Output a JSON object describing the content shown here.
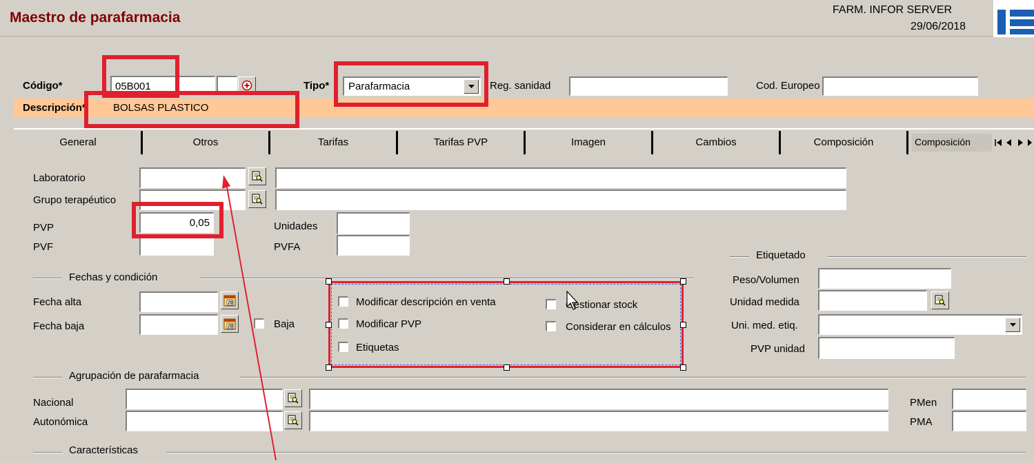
{
  "header": {
    "title": "Maestro de parafarmacia",
    "server": "FARM. INFOR SERVER",
    "date": "29/06/2018",
    "logo_text": "1S",
    "title_color": "#800000"
  },
  "top_form": {
    "codigo_label": "Código*",
    "codigo_value": "05B001",
    "tipo_label": "Tipo*",
    "tipo_value": "Parafarmacia",
    "reg_sanidad_label": "Reg. sanidad",
    "reg_sanidad_value": "",
    "cod_europeo_label": "Cod. Europeo",
    "cod_europeo_value": "",
    "descripcion_label": "Descripción*",
    "descripcion_value": "BOLSAS PLASTICO",
    "descripcion_bg": "#ffc896"
  },
  "tabs": [
    {
      "label": "General"
    },
    {
      "label": "Otros"
    },
    {
      "label": "Tarifas"
    },
    {
      "label": "Tarifas PVP"
    },
    {
      "label": "Imagen"
    },
    {
      "label": "Cambios"
    },
    {
      "label": "Composición"
    },
    {
      "label": "Composición"
    }
  ],
  "general": {
    "laboratorio_label": "Laboratorio",
    "grupo_label": "Grupo terapéutico",
    "pvp_label": "PVP",
    "pvp_value": "0,05",
    "pvf_label": "PVF",
    "unidades_label": "Unidades",
    "pvfa_label": "PVFA",
    "fechas_section": "Fechas y condición",
    "fecha_alta_label": "Fecha alta",
    "fecha_baja_label": "Fecha baja",
    "baja_label": "Baja",
    "checkboxes": {
      "mod_desc": "Modificar descripción en venta",
      "gestionar_stock": "Gestionar stock",
      "mod_pvp": "Modificar PVP",
      "considerar": "Considerar en cálculos",
      "etiquetas": "Etiquetas"
    },
    "etiquetado_section": "Etiquetado",
    "peso_label": "Peso/Volumen",
    "unidad_medida_label": "Unidad medida",
    "uni_med_etiq_label": "Uni. med. etiq.",
    "pvp_unidad_label": "PVP unidad",
    "agrupacion_section": "Agrupación de parafarmacia",
    "nacional_label": "Nacional",
    "autonomica_label": "Autonómica",
    "pmen_label": "PMen",
    "pma_label": "PMA",
    "caracteristicas_section": "Características"
  },
  "colors": {
    "highlight": "#e0202e",
    "window_bg": "#d4d0c8",
    "selection": "#e0202e"
  }
}
